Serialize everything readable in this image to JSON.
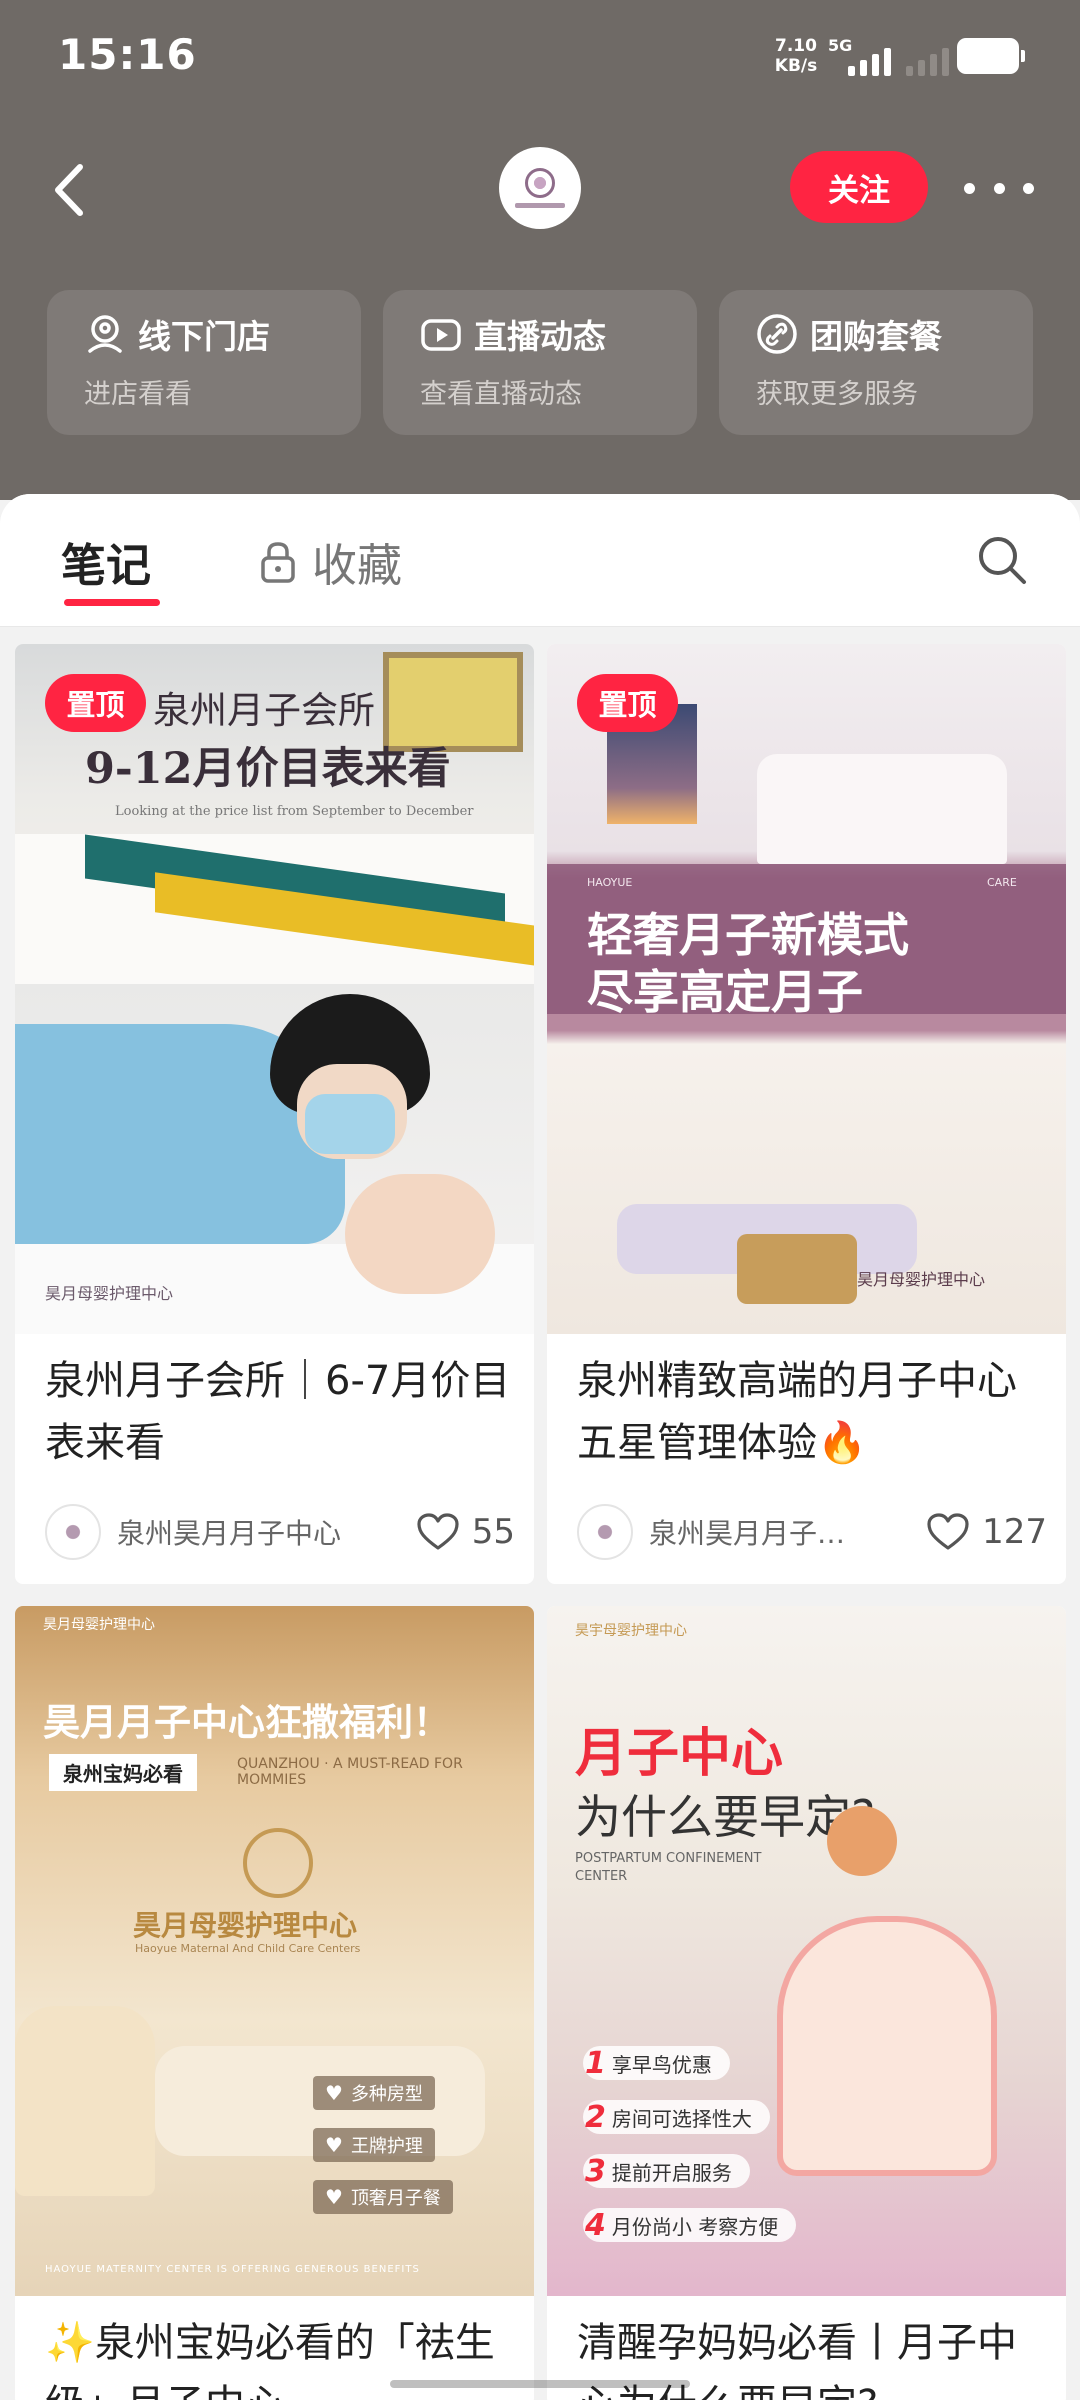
{
  "status_bar": {
    "time": "15:16",
    "net_speed_value": "7.10",
    "net_speed_unit": "KB/s",
    "network_type": "5G"
  },
  "nav": {
    "follow_label": "关注",
    "brand_logo_text": "昊月母婴护理中心"
  },
  "services": [
    {
      "title": "线下门店",
      "subtitle": "进店看看",
      "icon": "location-pin-icon"
    },
    {
      "title": "直播动态",
      "subtitle": "查看直播动态",
      "icon": "live-camera-icon"
    },
    {
      "title": "团购套餐",
      "subtitle": "获取更多服务",
      "icon": "link-icon"
    }
  ],
  "tabs": {
    "notes": "笔记",
    "collect": "收藏"
  },
  "notes": [
    {
      "pinned_label": "置顶",
      "title": "泉州月子会所｜6-7月价目表来看",
      "author": "泉州昊月月子中心",
      "likes": "55",
      "cover": {
        "line1": "泉州月子会所",
        "line2": "9-12月价目表来看",
        "en": "Looking at the price list from September to December",
        "logo": "昊月母婴护理中心"
      }
    },
    {
      "pinned_label": "置顶",
      "title": "泉州精致高端的月子中心 五星管理体验🔥",
      "author": "泉州昊月月子…",
      "likes": "127",
      "cover": {
        "line1": "轻奢月子新模式",
        "line2": "尽享高定月子",
        "brand_en": "HAOYUE",
        "care_en": "CARE",
        "logo": "昊月母婴护理中心"
      }
    },
    {
      "title": "✨泉州宝妈必看的「祛生级」月子中心",
      "cover": {
        "logo": "昊月母婴护理中心",
        "headline": "昊月月子中心狂撒福利！",
        "tag": "泉州宝妈必看",
        "sub_en": "QUANZHOU · A MUST-READ FOR MOMMIES",
        "wall_text": "昊月母婴护理中心",
        "wall_en": "Haoyue Maternal And Child Care Centers",
        "perks": [
          "多种房型",
          "王牌护理",
          "顶奢月子餐"
        ],
        "bottom_en": "HAOYUE MATERNITY CENTER IS OFFERING GENEROUS BENEFITS"
      }
    },
    {
      "title": "清醒孕妈妈必看丨月子中心为什么要早定?",
      "cover": {
        "logo": "昊宇母婴护理中心",
        "headline_red": "月子中心",
        "headline": "为什么要早定?",
        "en": "POSTPARTUM CONFINEMENT CENTER",
        "reasons": [
          "享早鸟优惠",
          "房间可选择性大",
          "提前开启服务",
          "月份尚小 考察方便"
        ]
      }
    }
  ],
  "colors": {
    "accent": "#ff2442",
    "header_bg": "#6f6a66",
    "service_card_bg": "#7f7a77"
  }
}
